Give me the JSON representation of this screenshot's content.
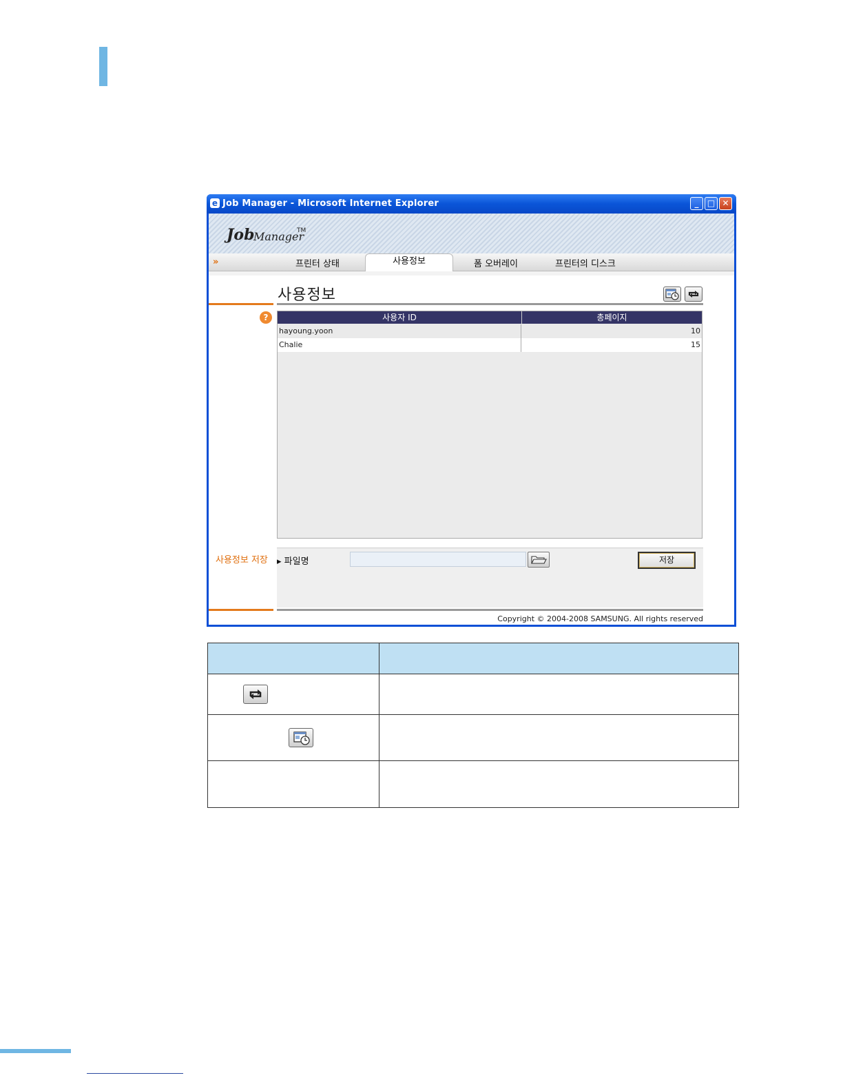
{
  "window": {
    "title": "Job Manager - Microsoft Internet Explorer",
    "ie_icon": "ie-logo-icon",
    "controls": [
      "minimize-icon",
      "maximize-icon",
      "close-icon"
    ]
  },
  "logo": {
    "job": "Job",
    "manager": "Manager",
    "tm": "TM"
  },
  "tabs": {
    "arrow": "»",
    "items": [
      {
        "label": "프린터 상태"
      },
      {
        "label": "사용정보"
      },
      {
        "label": "폼 오버레이"
      },
      {
        "label": "프린터의 디스크"
      }
    ],
    "active": "사용정보"
  },
  "page": {
    "title": "사용정보",
    "help_glyph": "?",
    "toolbar_icons": [
      "schedule-icon",
      "refresh-icon"
    ]
  },
  "grid": {
    "columns": [
      "사용자 ID",
      "총페이지"
    ],
    "rows": [
      {
        "user": "hayoung.yoon",
        "pages": "10"
      },
      {
        "user": "Chalie",
        "pages": "15"
      }
    ]
  },
  "save": {
    "section_label": "사용정보 저장",
    "filename_label": "▸ 파일명",
    "filename_value": "",
    "browse_icon": "folder-open-icon",
    "save_button": "저장"
  },
  "footer": {
    "copyright": "Copyright © 2004-2008 SAMSUNG. All rights reserved"
  },
  "desc_table": {
    "rows": [
      {
        "icon": "refresh-icon",
        "description": ""
      },
      {
        "icon": "schedule-icon",
        "description": ""
      },
      {
        "icon": "",
        "description": ""
      }
    ]
  },
  "colors": {
    "accent_blue": "#6fb6e3",
    "orange": "#e47a1c",
    "grid_header": "#343466",
    "table_header": "#bfe0f3"
  }
}
